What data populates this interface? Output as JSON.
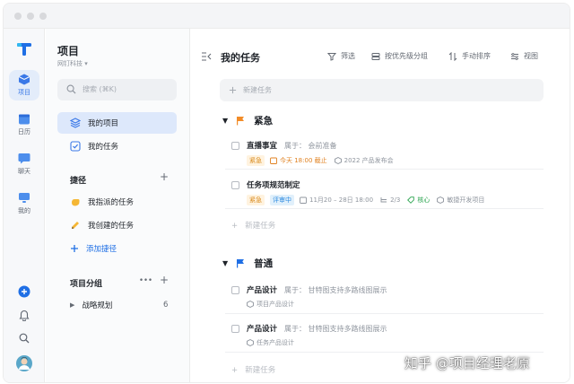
{
  "rail": {
    "items": [
      {
        "label": "项目"
      },
      {
        "label": "日历"
      },
      {
        "label": "聊天"
      },
      {
        "label": "我的"
      }
    ]
  },
  "sidebar": {
    "title": "项目",
    "subtitle": "网钉科技 ▾",
    "search_placeholder": "搜索 (⌘K)",
    "nav": [
      {
        "label": "我的项目"
      },
      {
        "label": "我的任务"
      }
    ],
    "shortcuts": {
      "title": "捷径",
      "items": [
        {
          "label": "我指派的任务"
        },
        {
          "label": "我创建的任务"
        },
        {
          "label": "添加捷径"
        }
      ]
    },
    "groups": {
      "title": "项目分组",
      "more": "•••",
      "items": [
        {
          "label": "战略规划",
          "count": "6"
        }
      ]
    }
  },
  "main": {
    "title": "我的任务",
    "toolbar": [
      {
        "label": "筛选"
      },
      {
        "label": "按优先级分组"
      },
      {
        "label": "手动排序"
      },
      {
        "label": "视图"
      }
    ],
    "new_task_placeholder": "新建任务",
    "groups": [
      {
        "name": "紧急",
        "flag_color": "#f28c28",
        "tasks": [
          {
            "title": "直播事宜",
            "belong": "属于：  会前准备",
            "tag": "紧急",
            "date": "今天 18:00 截止",
            "project": "2022 产品发布会"
          },
          {
            "title": "任务项规范制定",
            "belong": "",
            "tag": "紧急",
            "status": "评审中",
            "date": "11月20 – 28日 18:00",
            "subtasks": "2/3",
            "label": "核心",
            "project": "敏捷开发项目"
          }
        ],
        "add_label": "新建任务"
      },
      {
        "name": "普通",
        "flag_color": "#1f6fe5",
        "tasks": [
          {
            "title": "产品设计",
            "belong": "属于：  甘特图支持多路线图展示",
            "project": "项目产品设计"
          },
          {
            "title": "产品设计",
            "belong": "属于：  甘特图支持多路线图展示",
            "project": "任务产品设计"
          }
        ],
        "add_label": "新建任务"
      }
    ]
  },
  "watermark": "知乎 @项目经理老原",
  "colors": {
    "accent": "#3a78e7",
    "urgent_flag": "#f28c28",
    "normal_flag": "#1f6fe5",
    "due_today": "#e0801f",
    "tag_green": "#2aa44f"
  }
}
